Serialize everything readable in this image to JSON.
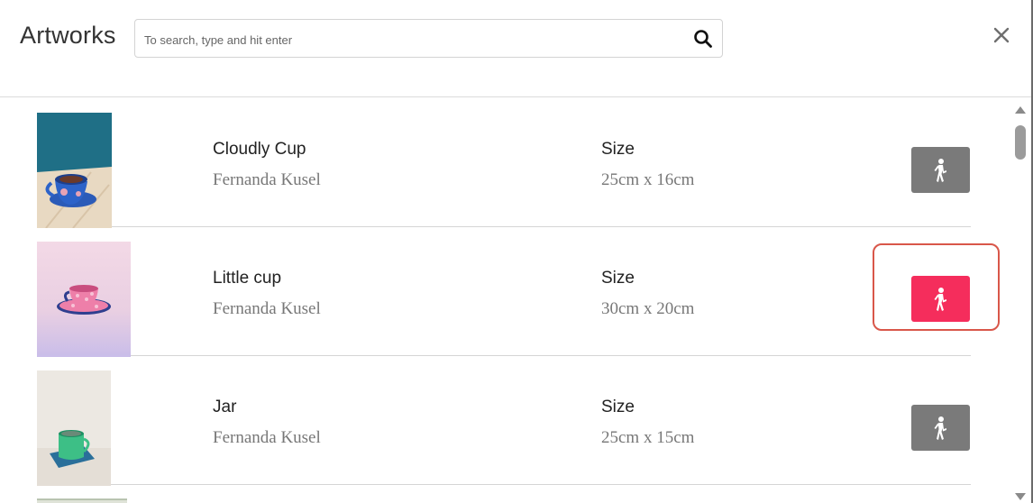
{
  "header": {
    "title": "Artworks",
    "search_placeholder": "To search, type and hit enter",
    "search_value": ""
  },
  "icons": {
    "search": "search-icon",
    "close": "close-icon",
    "walk": "walking-person-icon"
  },
  "colors": {
    "accent": "#f52d5c",
    "button_default": "#7a7a7a",
    "highlight_outline": "#d9574a"
  },
  "artworks": [
    {
      "title": "Cloudly Cup",
      "artist": "Fernanda Kusel",
      "size_label": "Size",
      "size": "25cm x 16cm",
      "active": false
    },
    {
      "title": "Little cup",
      "artist": "Fernanda Kusel",
      "size_label": "Size",
      "size": "30cm x 20cm",
      "active": true
    },
    {
      "title": "Jar",
      "artist": "Fernanda Kusel",
      "size_label": "Size",
      "size": "25cm x 15cm",
      "active": false
    }
  ]
}
